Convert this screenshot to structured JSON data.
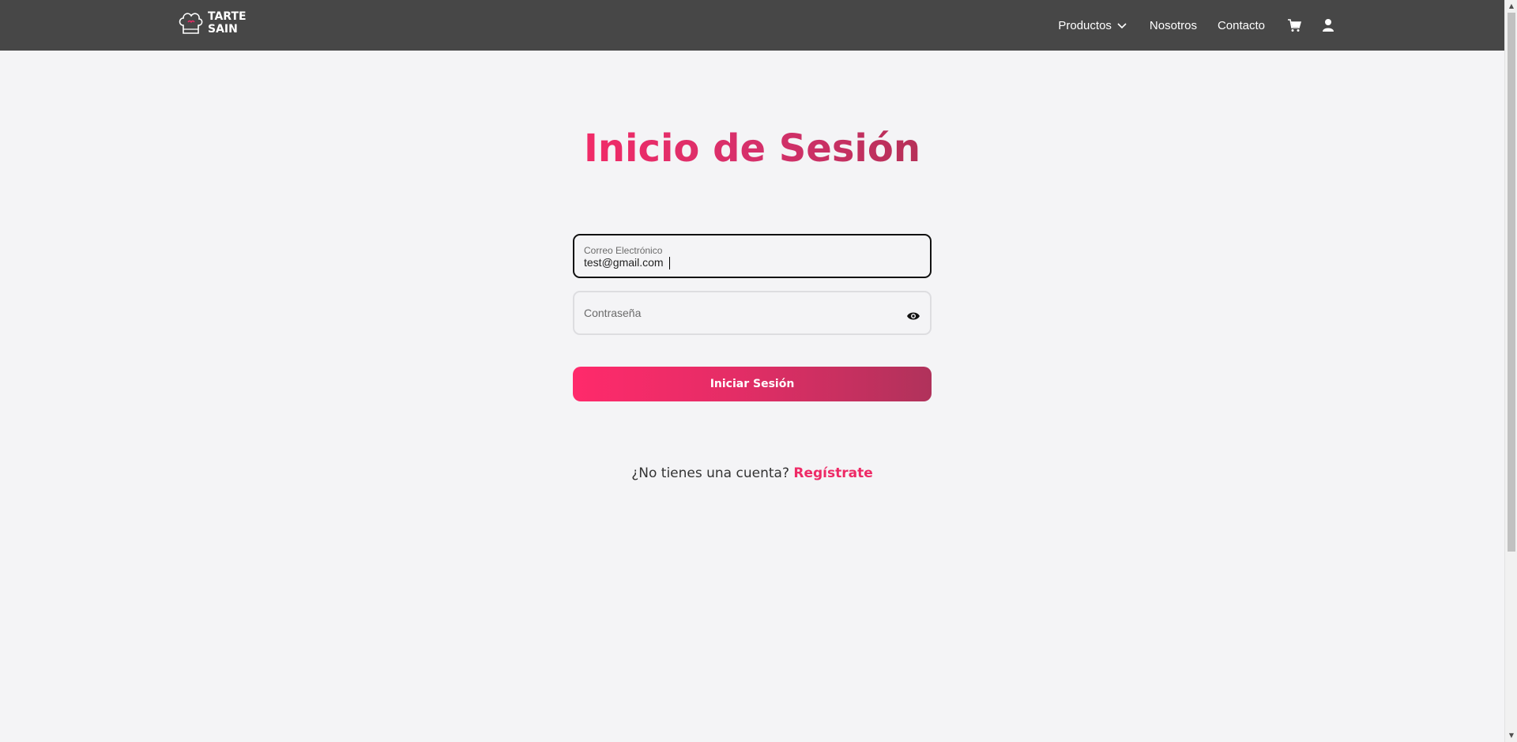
{
  "brand": {
    "line1": "TARTE",
    "line2": "SAIN"
  },
  "nav": {
    "products": "Productos",
    "about": "Nosotros",
    "contact": "Contacto"
  },
  "login": {
    "title": "Inicio de Sesión",
    "email_label": "Correo Electrónico",
    "email_value": "test@gmail.com",
    "password_placeholder": "Contraseña",
    "submit": "Iniciar Sesión",
    "register_prompt": "¿No tienes una cuenta?",
    "register_link": "Regístrate"
  },
  "colors": {
    "navbar": "#474747",
    "accent": "#ee2a66",
    "accent_dark": "#b0325b",
    "background": "#f4f4f6"
  },
  "icons": {
    "logo": "chef-hat-icon",
    "products_dropdown": "chevron-down-icon",
    "cart": "cart-icon",
    "user": "user-icon",
    "password_toggle": "eye-icon"
  }
}
